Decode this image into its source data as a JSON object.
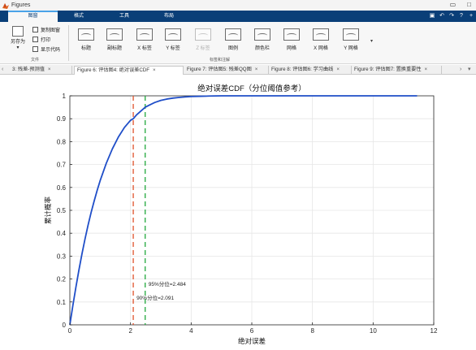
{
  "window": {
    "title": "Figures",
    "controls": [
      "▭",
      "□"
    ]
  },
  "ribbon_tabs": [
    "图窗",
    "格式",
    "工具",
    "布局"
  ],
  "quick_access": [
    "▣",
    "↶",
    "↷",
    "?",
    "+"
  ],
  "file_group": {
    "save_as": "另存为",
    "copy_figure": "复制图窗",
    "print": "打印",
    "show_code": "显示代码",
    "label": "文件"
  },
  "label_group": {
    "buttons": [
      "标题",
      "副标题",
      "X 标签",
      "Y 标签",
      "Z 标签",
      "图例",
      "颜色栏",
      "网格",
      "X 网格",
      "Y 网格"
    ],
    "disabled": [
      false,
      false,
      false,
      false,
      true,
      false,
      false,
      false,
      false,
      false
    ],
    "label": "标签和注解"
  },
  "doc_tabs": [
    "3: 残差-预测值",
    "Figure 6: 评估图4: 绝对误差CDF",
    "Figure 7: 评估图5: 残差QQ图",
    "Figure 8: 评估图6: 学习曲线",
    "Figure 9: 评估图7: 置换重要性"
  ],
  "active_tab": 1,
  "chart_data": {
    "type": "line",
    "title": "绝对误差CDF（分位阈值参考）",
    "xlabel": "绝对误差",
    "ylabel": "累计概率",
    "xlim": [
      0,
      12
    ],
    "ylim": [
      0,
      1
    ],
    "xticks": [
      0,
      2,
      4,
      6,
      8,
      10,
      12
    ],
    "yticks": [
      0,
      0.1,
      0.2,
      0.3,
      0.4,
      0.5,
      0.6,
      0.7,
      0.8,
      0.9,
      1
    ],
    "grid": true,
    "series": [
      {
        "x": [
          0,
          0.1,
          0.2,
          0.3,
          0.4,
          0.5,
          0.6,
          0.7,
          0.8,
          0.9,
          1.0,
          1.2,
          1.4,
          1.6,
          1.8,
          2.0,
          2.091,
          2.2,
          2.484,
          2.6,
          2.8,
          3.0,
          3.2,
          3.4,
          3.6,
          3.8,
          4.0,
          4.3,
          4.6,
          5.0,
          6.0,
          7.0,
          8.0,
          9.0,
          10.0,
          11.45
        ],
        "y": [
          0,
          0.085,
          0.165,
          0.24,
          0.31,
          0.375,
          0.435,
          0.49,
          0.54,
          0.587,
          0.63,
          0.705,
          0.768,
          0.82,
          0.862,
          0.893,
          0.9,
          0.917,
          0.95,
          0.958,
          0.971,
          0.98,
          0.986,
          0.99,
          0.993,
          0.995,
          0.997,
          0.998,
          0.999,
          1,
          1,
          1,
          1,
          1,
          1,
          1
        ],
        "color": "#1f4ec8"
      }
    ],
    "vlines": [
      {
        "x": 2.091,
        "color": "#e0522b",
        "label": "90%分位=2.091",
        "label_y": 0.12
      },
      {
        "x": 2.484,
        "color": "#21a83c",
        "label": "95%分位=2.484",
        "label_y": 0.18
      }
    ]
  }
}
